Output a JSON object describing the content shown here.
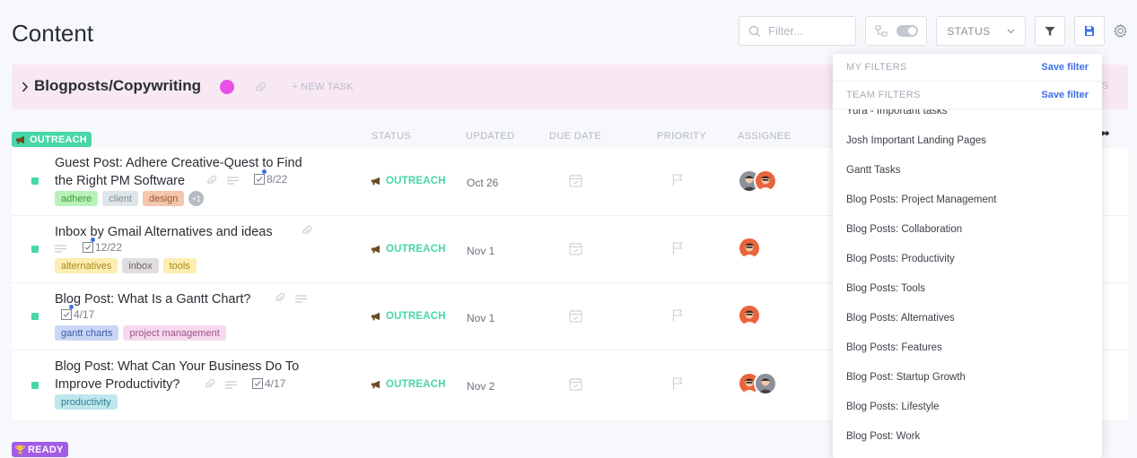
{
  "page": {
    "title": "Content"
  },
  "toolbar": {
    "filter_placeholder": "Filter...",
    "status_label": "STATUS"
  },
  "group": {
    "title": "Blogposts/Copywriting",
    "new_task": "+ NEW TASK",
    "color": "#e851e8"
  },
  "status_groups": {
    "outreach": "OUTREACH",
    "ready": "READY"
  },
  "columns": {
    "status": "STATUS",
    "updated": "UPDATED",
    "due_date": "DUE DATE",
    "priority": "PRIORITY",
    "assignee": "ASSIGNEE"
  },
  "tasks": [
    {
      "name_line1": "Guest Post: Adhere Creative-Quest to Find",
      "name_line2": "the Right PM Software",
      "checklist": "8/22",
      "tags": [
        {
          "label": "adhere",
          "bg": "#b9f2b9",
          "fg": "#3a9b3a"
        },
        {
          "label": "client",
          "bg": "#dfe6e9",
          "fg": "#7d8a91"
        },
        {
          "label": "design",
          "bg": "#f3c6ad",
          "fg": "#a35632"
        }
      ],
      "extra_tags": "+1",
      "status": "OUTREACH",
      "updated": "Oct 26"
    },
    {
      "name_line1": "Inbox by Gmail Alternatives and ideas",
      "checklist": "12/22",
      "tags": [
        {
          "label": "alternatives",
          "bg": "#fbeeb0",
          "fg": "#a58a1c"
        },
        {
          "label": "inbox",
          "bg": "#e0dde0",
          "fg": "#6a646a"
        },
        {
          "label": "tools",
          "bg": "#fbeeb0",
          "fg": "#a58a1c"
        }
      ],
      "status": "OUTREACH",
      "updated": "Nov 1"
    },
    {
      "name_line1": "Blog Post: What Is a Gantt Chart?",
      "checklist": "4/17",
      "tags": [
        {
          "label": "gantt charts",
          "bg": "#c9d6f6",
          "fg": "#3d5aa8"
        },
        {
          "label": "project management",
          "bg": "#f6d9ee",
          "fg": "#a0508a"
        }
      ],
      "status": "OUTREACH",
      "updated": "Nov 1"
    },
    {
      "name_line1": "Blog Post: What Can Your Business Do To",
      "name_line2": "Improve Productivity?",
      "checklist": "4/17",
      "tags": [
        {
          "label": "productivity",
          "bg": "#bfe7ee",
          "fg": "#2c7f8e"
        }
      ],
      "status": "OUTREACH",
      "updated": "Nov 2"
    }
  ],
  "filters_dropdown": {
    "my_filters": "MY FILTERS",
    "team_filters": "TEAM FILTERS",
    "save_filter": "Save filter",
    "items": [
      "Yura - Important tasks",
      "Josh Important Landing Pages",
      "Gantt Tasks",
      "Blog Posts: Project Management",
      "Blog Posts: Collaboration",
      "Blog Posts: Productivity",
      "Blog Posts: Tools",
      "Blog Posts: Alternatives",
      "Blog Posts: Features",
      "Blog Post: Startup Growth",
      "Blog Posts: Lifestyle",
      "Blog Post: Work"
    ]
  },
  "colors": {
    "outreach": "#47d7a8",
    "ready": "#a35ce8",
    "accent": "#3d6fe5"
  },
  "icons": [
    "search-icon",
    "hierarchy-icon",
    "toggle-icon",
    "chevron-down-icon",
    "funnel-icon",
    "save-icon",
    "gear-icon",
    "chevron-right-icon",
    "paperclip-icon",
    "lines-icon",
    "checklist-icon",
    "megaphone-icon",
    "trophy-icon",
    "calendar-icon",
    "flag-icon",
    "more-icon"
  ]
}
